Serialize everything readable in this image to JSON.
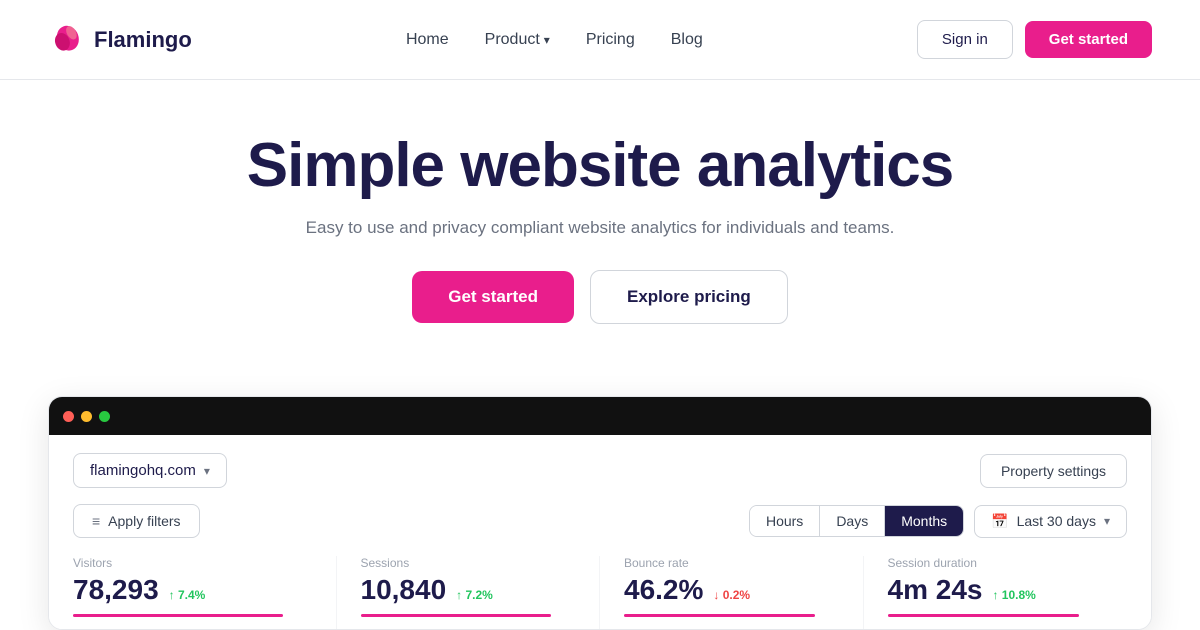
{
  "navbar": {
    "logo_text": "Flamingo",
    "nav_links": [
      {
        "label": "Home",
        "id": "home"
      },
      {
        "label": "Product",
        "id": "product",
        "has_dropdown": true
      },
      {
        "label": "Pricing",
        "id": "pricing"
      },
      {
        "label": "Blog",
        "id": "blog"
      }
    ],
    "signin_label": "Sign in",
    "get_started_label": "Get started"
  },
  "hero": {
    "title": "Simple website analytics",
    "subtitle": "Easy to use and privacy compliant website analytics for individuals and teams.",
    "cta_primary": "Get started",
    "cta_secondary": "Explore pricing"
  },
  "dashboard": {
    "titlebar_dots": [
      "red",
      "yellow",
      "green"
    ],
    "site_selector": {
      "value": "flamingohq.com",
      "chevron": "▾"
    },
    "property_settings_label": "Property settings",
    "apply_filters_label": "Apply filters",
    "time_buttons": [
      {
        "label": "Hours",
        "active": false
      },
      {
        "label": "Days",
        "active": false
      },
      {
        "label": "Months",
        "active": true
      }
    ],
    "date_range_label": "Last 30 days",
    "metrics": [
      {
        "label": "Visitors",
        "value": "78,293",
        "change": "↑ 7.4%",
        "change_direction": "up"
      },
      {
        "label": "Sessions",
        "value": "10,840",
        "change": "↑ 7.2%",
        "change_direction": "up"
      },
      {
        "label": "Bounce rate",
        "value": "46.2%",
        "change": "↓ 0.2%",
        "change_direction": "down"
      },
      {
        "label": "Session duration",
        "value": "4m 24s",
        "change": "↑ 10.8%",
        "change_direction": "up"
      }
    ]
  }
}
